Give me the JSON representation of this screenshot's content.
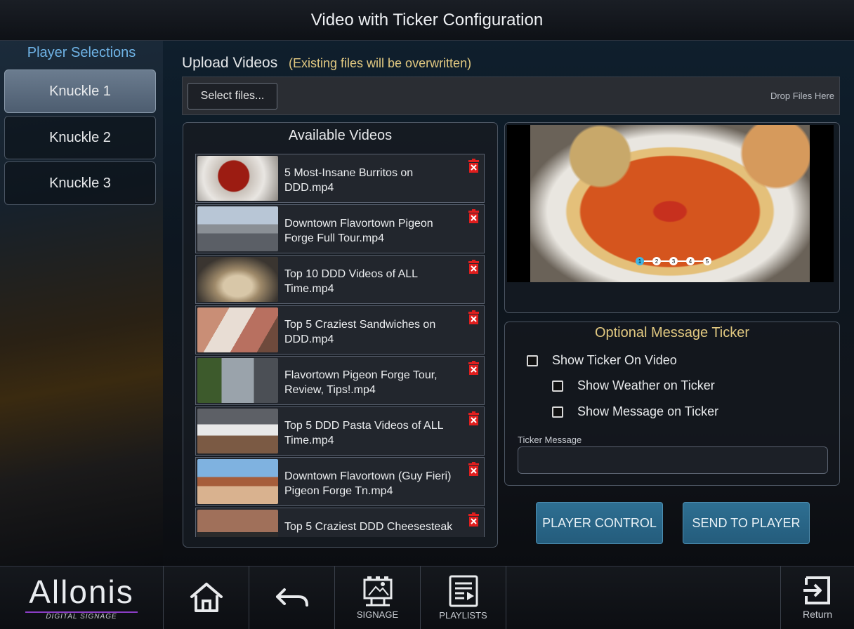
{
  "header": {
    "title": "Video with Ticker Configuration"
  },
  "sidebar": {
    "title": "Player Selections",
    "players": [
      {
        "label": "Knuckle 1",
        "active": true
      },
      {
        "label": "Knuckle 2",
        "active": false
      },
      {
        "label": "Knuckle 3",
        "active": false
      }
    ]
  },
  "upload": {
    "label": "Upload Videos",
    "note": "(Existing files will be overwritten)",
    "select_button": "Select files...",
    "drop_hint": "Drop Files Here"
  },
  "videos": {
    "title": "Available Videos",
    "items": [
      {
        "name": "5 Most-Insane Burritos on DDD.mp4"
      },
      {
        "name": "Downtown Flavortown Pigeon Forge Full Tour.mp4"
      },
      {
        "name": "Top 10 DDD Videos of ALL Time.mp4"
      },
      {
        "name": "Top 5 Craziest Sandwiches on DDD.mp4"
      },
      {
        "name": "Flavortown Pigeon Forge Tour, Review, Tips!.mp4"
      },
      {
        "name": "Top 5 DDD Pasta Videos of ALL Time.mp4"
      },
      {
        "name": "Downtown Flavortown (Guy Fieri) Pigeon Forge Tn.mp4"
      },
      {
        "name": "Top 5 Craziest DDD Cheesesteak"
      }
    ]
  },
  "preview": {
    "steps": [
      "1",
      "2",
      "3",
      "4",
      "5"
    ],
    "active_step": 1
  },
  "ticker": {
    "title": "Optional Message Ticker",
    "show_ticker": "Show Ticker On Video",
    "show_weather": "Show Weather on Ticker",
    "show_message": "Show Message on Ticker",
    "message_label": "Ticker Message",
    "message_value": ""
  },
  "actions": {
    "player_control": "PLAYER CONTROL",
    "send_to_player": "SEND TO PLAYER"
  },
  "bottom_nav": {
    "logo_text": "Allonis",
    "logo_sub": "DIGITAL SIGNAGE",
    "signage": "SIGNAGE",
    "playlists": "PLAYLISTS",
    "return": "Return"
  },
  "colors": {
    "accent_gold": "#e2c981",
    "accent_blue": "#6fb3e6",
    "button_blue": "#2e6f92",
    "trash_red": "#e01e1e"
  }
}
